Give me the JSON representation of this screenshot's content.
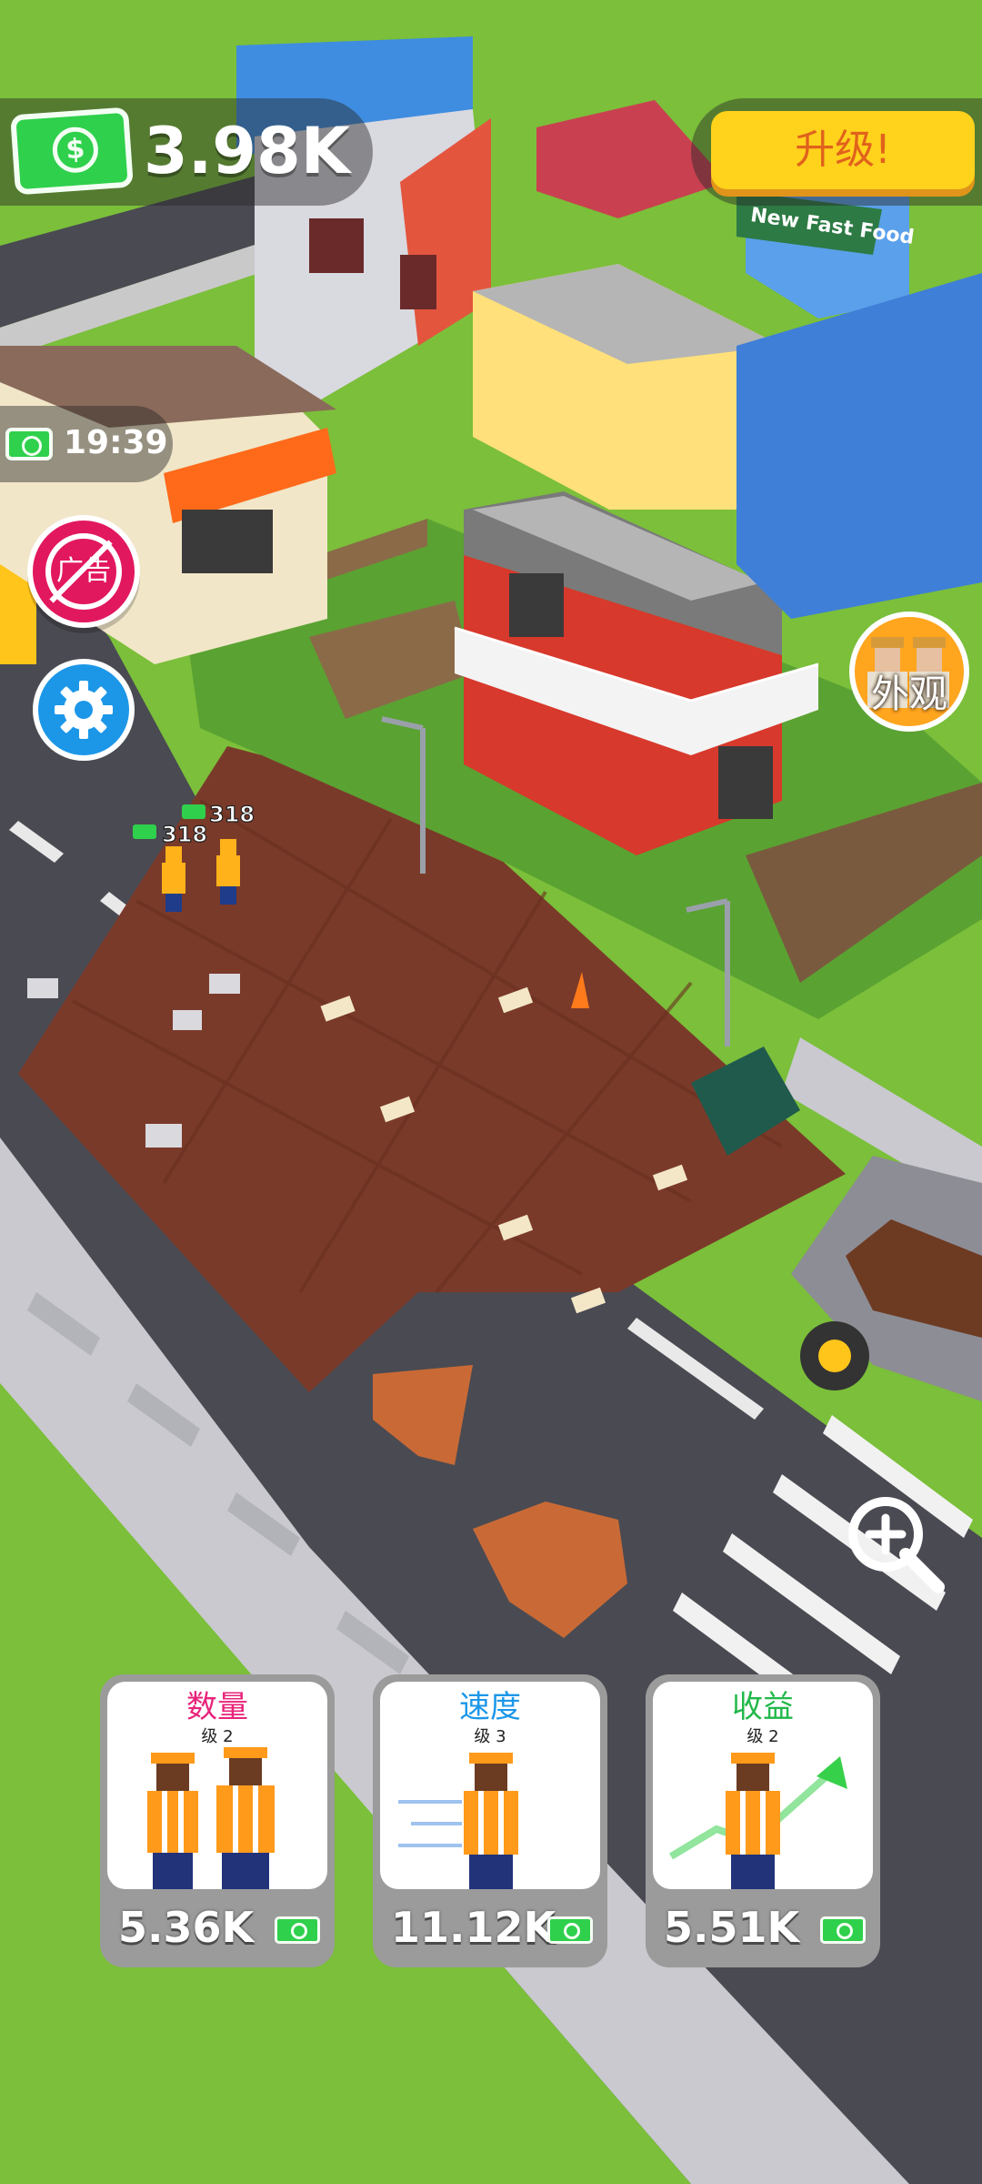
{
  "hud": {
    "money": "3.98K",
    "money_icon": "cash-icon",
    "upgrade_label": "升级!",
    "timer": "19:39",
    "no_ads_label": "广告",
    "look_label": "外观"
  },
  "scene": {
    "store_sign": "New Fast Food",
    "worker_earnings": [
      "318",
      "318"
    ]
  },
  "cards": [
    {
      "title": "数量",
      "level": "级 2",
      "price": "5.36K",
      "title_color": "#e8237a"
    },
    {
      "title": "速度",
      "level": "级 3",
      "price": "11.12K",
      "title_color": "#1c97e8"
    },
    {
      "title": "收益",
      "level": "级 2",
      "price": "5.51K",
      "title_color": "#22b84a"
    }
  ],
  "colors": {
    "grass": "#7bbf3a",
    "road": "#4a4a52",
    "dirt": "#7a3a2a",
    "money_green": "#2fd04c",
    "upgrade_yellow": "#ffd21c"
  }
}
